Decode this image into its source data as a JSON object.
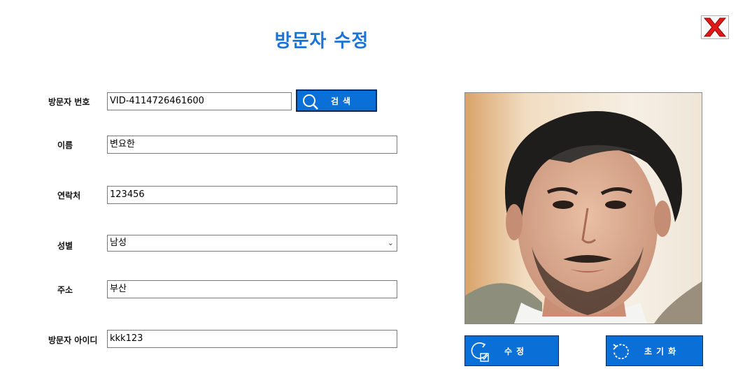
{
  "title": "방문자 수정",
  "close_button": {
    "icon": "close-x-icon",
    "color": "#e01818"
  },
  "form": {
    "visitor_id": {
      "label": "방문자 번호",
      "value": "VID-4114726461600"
    },
    "search_button": {
      "label": "검색",
      "icon": "search-icon"
    },
    "name": {
      "label": "이름",
      "value": "변요한"
    },
    "contact": {
      "label": "연락처",
      "value": "123456"
    },
    "gender": {
      "label": "성별",
      "value": "남성"
    },
    "address": {
      "label": "주소",
      "value": "부산"
    },
    "user_id": {
      "label": "방문자 아이디",
      "value": "kkk123"
    }
  },
  "buttons": {
    "modify": {
      "label": "수정",
      "icon": "refresh-check-icon"
    },
    "reset": {
      "label": "초기화",
      "icon": "reset-icon"
    }
  },
  "colors": {
    "accent": "#0b6fd8",
    "title": "#1a73d9",
    "close": "#e01818"
  }
}
